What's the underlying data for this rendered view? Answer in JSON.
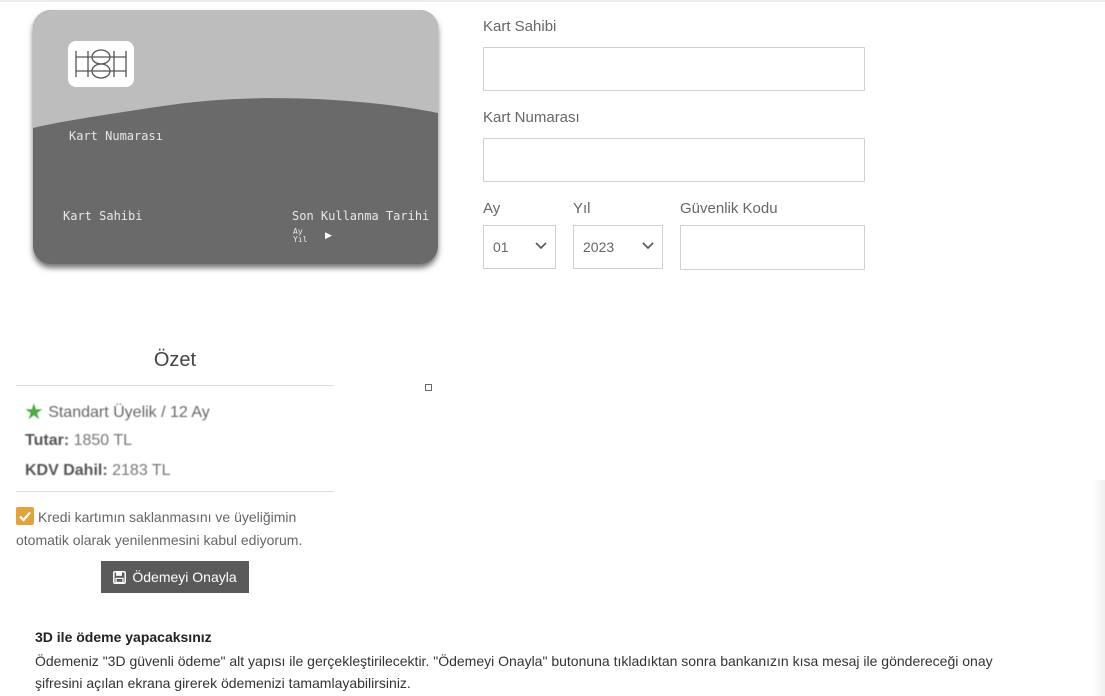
{
  "card_preview": {
    "number_label": "Kart Numarası",
    "holder_label": "Kart Sahibi",
    "expiry_label": "Son Kullanma Tarihi",
    "month_short": "Ay",
    "year_short": "Yıl",
    "arrow": "▶"
  },
  "form": {
    "holder_label": "Kart Sahibi",
    "holder_value": "",
    "number_label": "Kart Numarası",
    "number_value": "",
    "month_label": "Ay",
    "month_value": "01",
    "year_label": "Yıl",
    "year_value": "2023",
    "cvv_label": "Güvenlik Kodu",
    "cvv_value": ""
  },
  "summary": {
    "title": "Özet",
    "plan": "Standart Üyelik / 12 Ay",
    "amount_label": "Tutar:",
    "amount_value": "1850 TL",
    "vat_label": "KDV Dahil:",
    "vat_value": "2183 TL"
  },
  "consent": {
    "checked": true,
    "text": "Kredi kartımın saklanmasını ve üyeliğimin otomatik olarak yenilenmesini kabul ediyorum."
  },
  "confirm_button": {
    "label": "Ödemeyi Onayla"
  },
  "info": {
    "title": "3D ile ödeme yapacaksınız",
    "text": "Ödemeniz \"3D güvenli ödeme\" alt yapısı ile gerçekleştirilecektir. \"Ödemeyi Onayla\" butonuna tıkladıktan sonra bankanızın kısa mesaj ile göndereceği onay şifresini açılan ekrana girerek ödemenizi tamamlayabilirsiniz."
  },
  "colors": {
    "card_top": "#bdbdbd",
    "card_bottom": "#6a6a6a",
    "checkbox": "#e4a33a",
    "star": "#4caa4c",
    "button": "#5a5a5a"
  },
  "icons": {
    "chip": "card-chip-icon",
    "star": "star-icon",
    "save": "floppy-disk-icon",
    "chevron": "chevron-down-icon",
    "check": "check-icon"
  }
}
